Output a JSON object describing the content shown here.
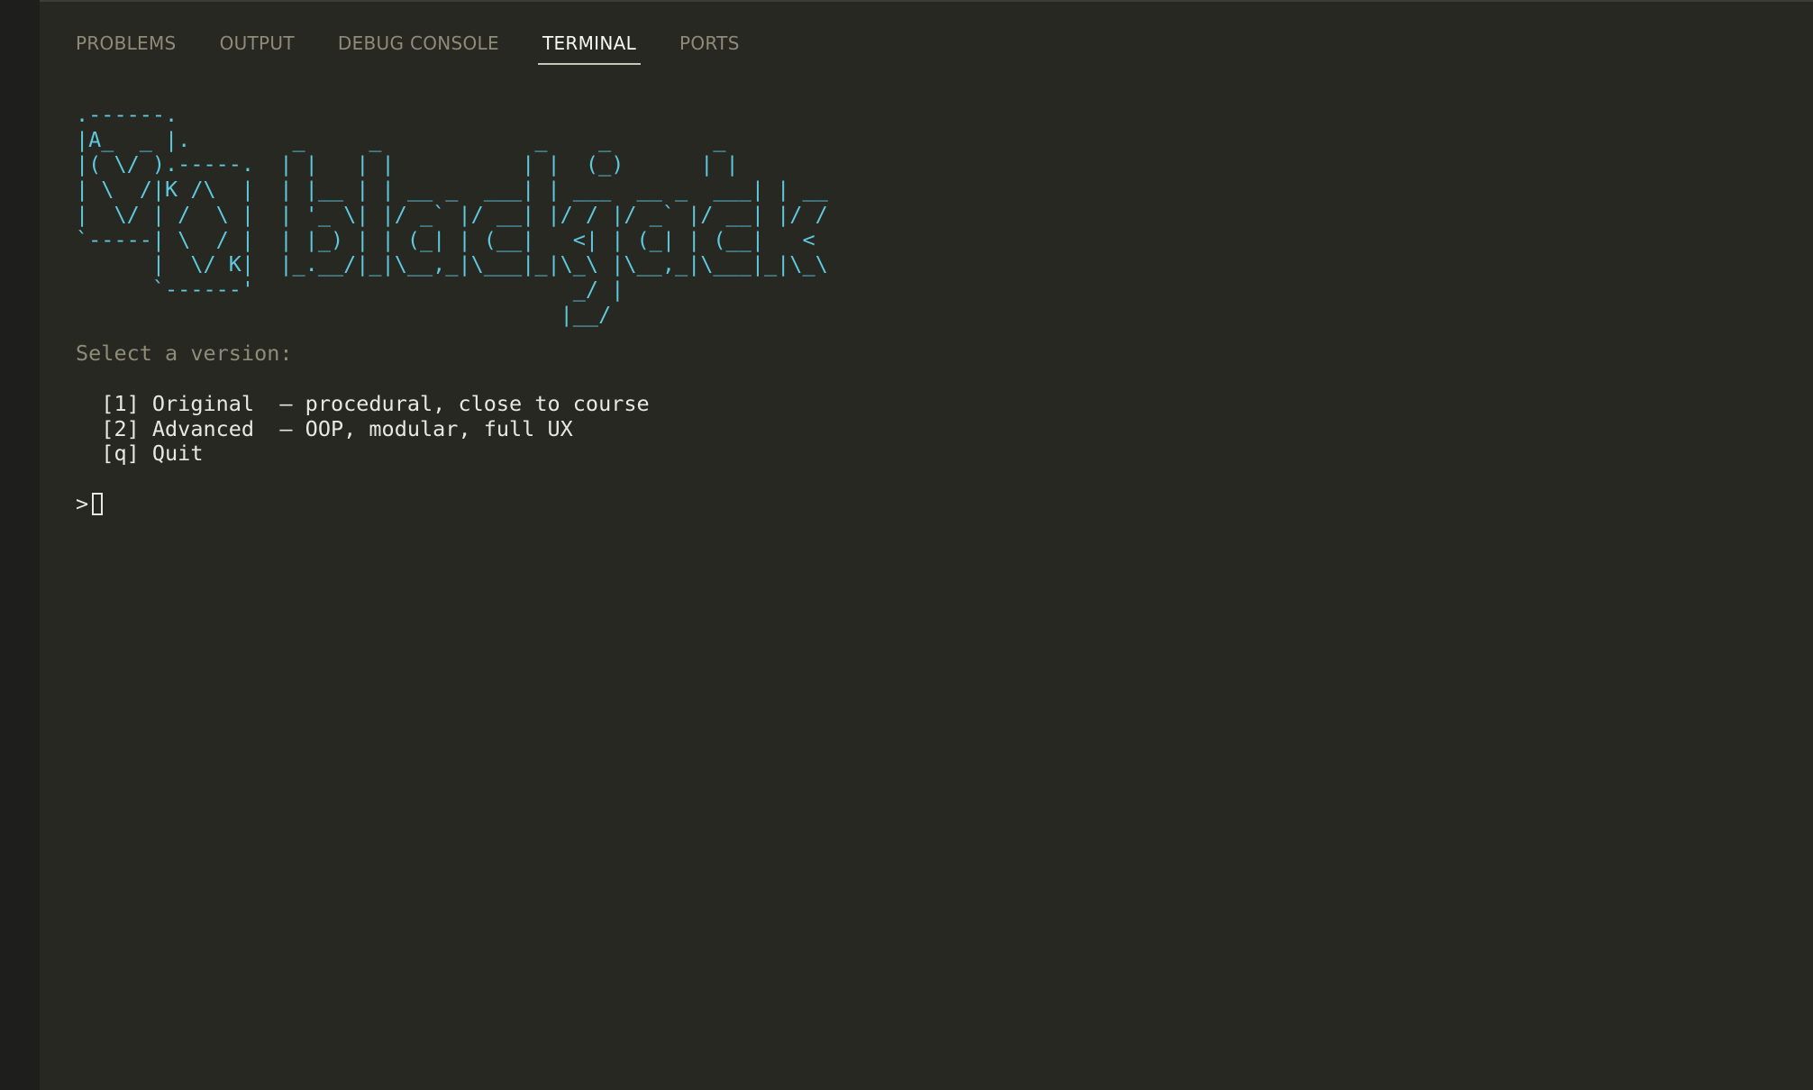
{
  "tabs": [
    {
      "label": "PROBLEMS",
      "active": false
    },
    {
      "label": "OUTPUT",
      "active": false
    },
    {
      "label": "DEBUG CONSOLE",
      "active": false
    },
    {
      "label": "TERMINAL",
      "active": true
    },
    {
      "label": "PORTS",
      "active": false
    }
  ],
  "terminal": {
    "ascii_banner": ".------.                                           \n|A_  _ |.        _     _            _    _        _   \n|( \\/ ).-----.  | |   | |          | |  (_)      | |  \n| \\  /|K /\\  |  | |__ | | __ _  ___| | ___  __ _  ___| | __\n|  \\/ | /  \\ |  | '_ \\| |/ _` |/ __| |/ / |/ _` |/ __| |/ /\n`-----| \\  / |  | |_) | | (_| | (__|   <| | (_| | (__|   < \n      |  \\/ K|  |_.__/|_|\\__,_|\\___|_|\\_\\ |\\__,_|\\___|_|\\_\\\n      `------'                         _/ |              \n                                      |__/               ",
    "select_prompt": "Select a version:",
    "options": [
      "  [1] Original  — procedural, close to course",
      "  [2] Advanced  — OOP, modular, full UX",
      "  [q] Quit"
    ],
    "input_prompt": ">"
  },
  "colors": {
    "background": "#272822",
    "ascii_accent": "#5ec8dc",
    "text": "#e8e8e2",
    "muted": "#8e8c78"
  }
}
